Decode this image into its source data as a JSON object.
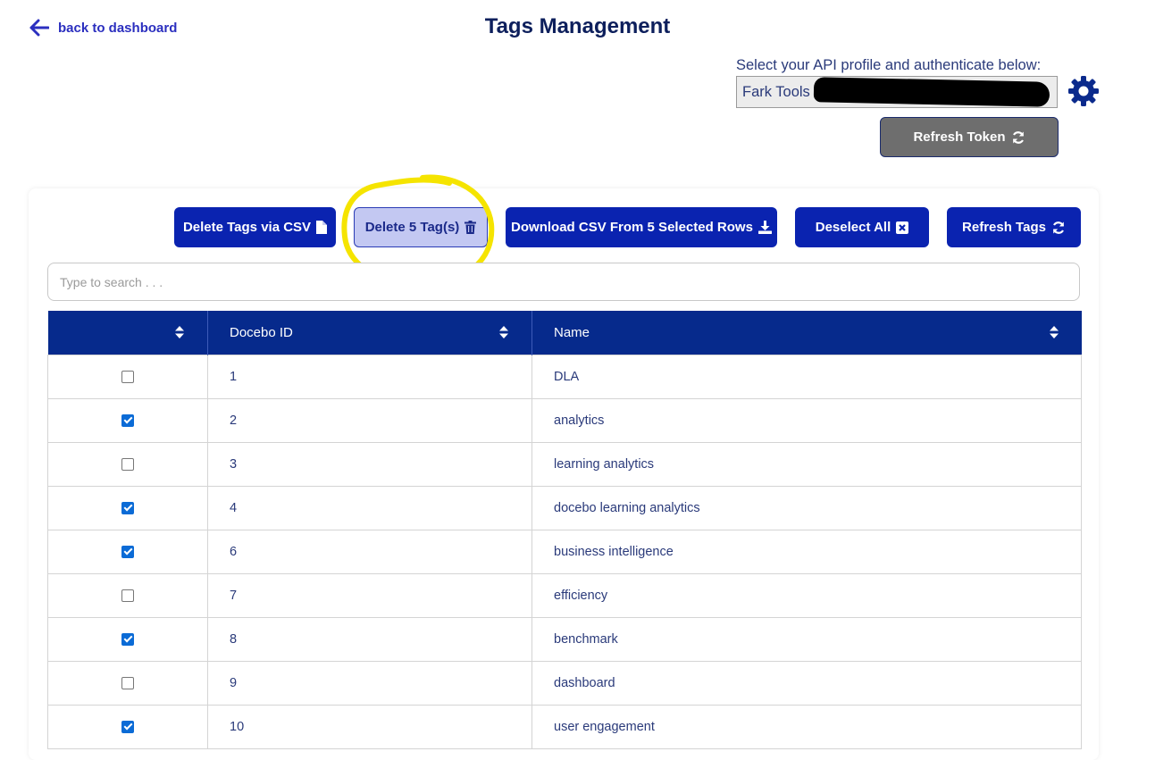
{
  "header": {
    "back_label": "back to dashboard",
    "title": "Tags Management"
  },
  "api": {
    "label": "Select your API profile and authenticate below:",
    "selected_profile": "Fark Tools",
    "refresh_token_label": "Refresh Token"
  },
  "toolbar": {
    "delete_csv_label": "Delete Tags via CSV",
    "delete_selected_label": "Delete 5 Tag(s)",
    "download_label": "Download CSV From 5 Selected Rows",
    "deselect_label": "Deselect All",
    "refresh_tags_label": "Refresh Tags"
  },
  "search": {
    "placeholder": "Type to search . . ."
  },
  "table": {
    "columns": [
      "",
      "Docebo ID",
      "Name"
    ],
    "rows": [
      {
        "checked": false,
        "id": "1",
        "name": "DLA"
      },
      {
        "checked": true,
        "id": "2",
        "name": "analytics"
      },
      {
        "checked": false,
        "id": "3",
        "name": "learning analytics"
      },
      {
        "checked": true,
        "id": "4",
        "name": "docebo learning analytics"
      },
      {
        "checked": true,
        "id": "6",
        "name": "business intelligence"
      },
      {
        "checked": false,
        "id": "7",
        "name": "efficiency"
      },
      {
        "checked": true,
        "id": "8",
        "name": "benchmark"
      },
      {
        "checked": false,
        "id": "9",
        "name": "dashboard"
      },
      {
        "checked": true,
        "id": "10",
        "name": "user engagement"
      }
    ]
  },
  "colors": {
    "primary": "#0a23b0",
    "header_bg": "#062a8c",
    "highlight": "#f5e400",
    "title": "#0d1f5c"
  },
  "icons": [
    "arrow-left-icon",
    "gear-icon",
    "sync-icon",
    "file-icon",
    "trash-icon",
    "download-icon",
    "close-box-icon",
    "sort-icon"
  ]
}
